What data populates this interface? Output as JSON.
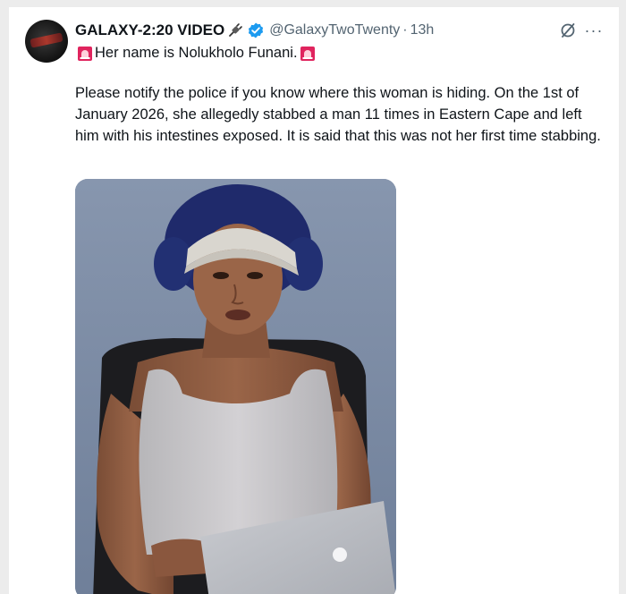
{
  "tweet": {
    "display_name": "GALAXY-2:20 VIDEO",
    "handle": "@GalaxyTwoTwenty",
    "separator": "·",
    "time": "13h",
    "more_label": "···",
    "headline": "Her name is Nolukholo Funani.",
    "body": "Please notify the police if you know where this woman is hiding. On the 1st of January 2026, she allegedly stabbed a man 11 times in Eastern Cape and left him with his intestines exposed. It is said that this was not her first time stabbing."
  },
  "icons": {
    "plug": "plug-icon",
    "verified": "verified-badge-icon",
    "grok": "grok-icon",
    "more": "more-icon",
    "siren": "police-siren-emoji"
  },
  "colors": {
    "verified": "#1d9bf0",
    "secondary_text": "#536471",
    "siren": "#e0245e"
  }
}
